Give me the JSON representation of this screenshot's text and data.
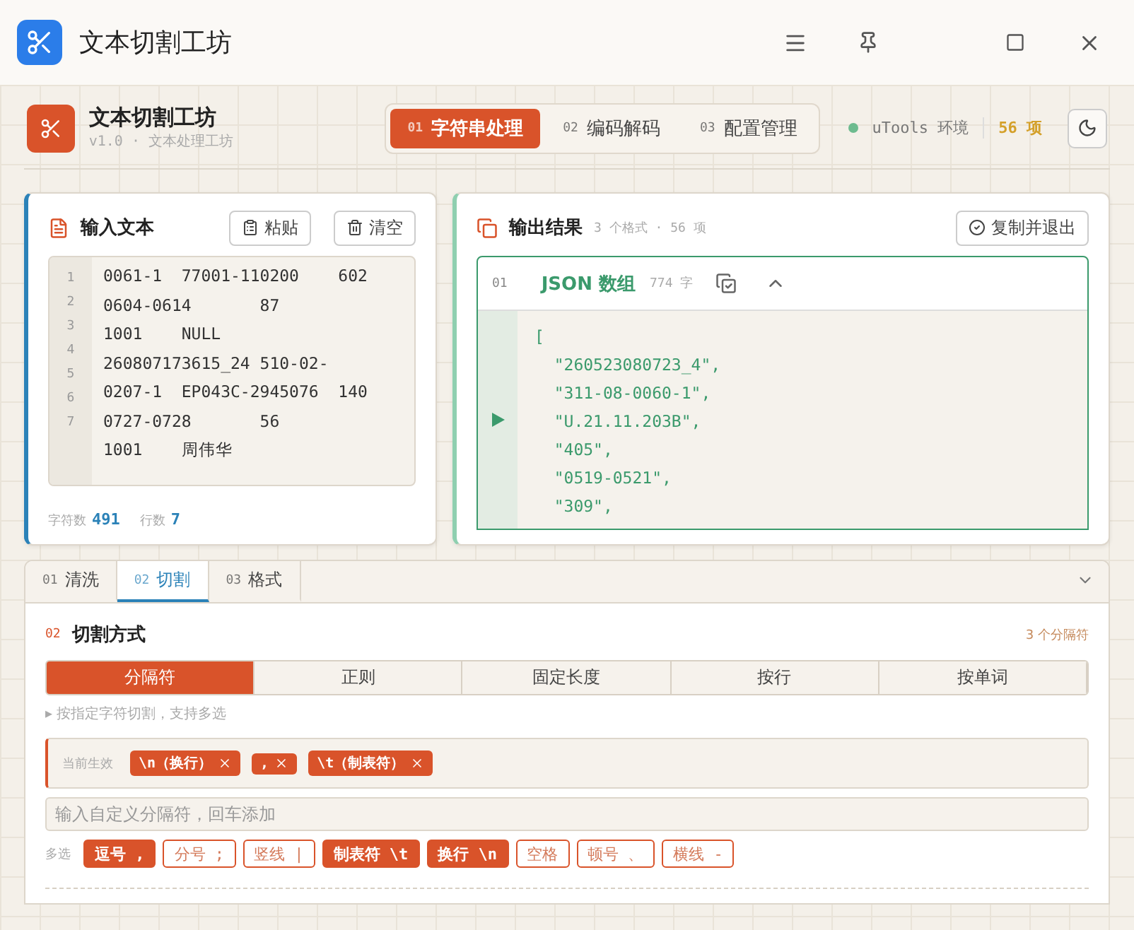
{
  "window": {
    "title": "文本切割工坊"
  },
  "header": {
    "app_name": "文本切割工坊",
    "subtitle": "v1.0 · 文本处理工坊",
    "env_label": "uTools 环境",
    "count": "56 项",
    "tabs": [
      {
        "index": "01",
        "label": "字符串处理",
        "selected": true
      },
      {
        "index": "02",
        "label": "编码解码",
        "selected": false
      },
      {
        "index": "03",
        "label": "配置管理",
        "selected": false
      }
    ]
  },
  "input_panel": {
    "title": "输入文本",
    "paste": "粘贴",
    "clear": "清空",
    "line_numbers": [
      "1",
      "2",
      "3",
      "4",
      "5",
      "6",
      "7"
    ],
    "lines": [
      "0061-1  77001-110200    602",
      "0604-0614       87",
      "1001    NULL",
      "260807173615_24 510-02-",
      "0207-1  EP043C-2945076  140",
      "0727-0728       56",
      "1001    周伟华"
    ],
    "stats": [
      {
        "label": "字符数",
        "value": "491"
      },
      {
        "label": "行数",
        "value": "7"
      }
    ]
  },
  "output_panel": {
    "title": "输出结果",
    "meta": "3 个格式 · 56 项",
    "copy_exit": "复制并退出",
    "block": {
      "index": "01",
      "name": "JSON 数组",
      "size": "774 字",
      "expanded": true,
      "lines": [
        "[",
        "  \"260523080723_4\",",
        "  \"311-08-0060-1\",",
        "  \"U.21.11.203B\",",
        "  \"405\",",
        "  \"0519-0521\",",
        "  \"309\","
      ]
    }
  },
  "settings": {
    "tabs": [
      {
        "index": "01",
        "label": "清洗",
        "selected": false
      },
      {
        "index": "02",
        "label": "切割",
        "selected": true
      },
      {
        "index": "03",
        "label": "格式",
        "selected": false
      }
    ],
    "section": {
      "index": "02",
      "title": "切割方式",
      "count": "3 个分隔符"
    },
    "modes": [
      {
        "label": "分隔符",
        "selected": true
      },
      {
        "label": "正则",
        "selected": false
      },
      {
        "label": "固定长度",
        "selected": false
      },
      {
        "label": "按行",
        "selected": false
      },
      {
        "label": "按单词",
        "selected": false
      }
    ],
    "hint": "▸ 按指定字符切割，支持多选",
    "active_label": "当前生效",
    "active_chips": [
      "\\n（换行）",
      ",",
      "\\t（制表符）"
    ],
    "custom_placeholder": "输入自定义分隔符，回车添加",
    "multi_label": "多选",
    "options": [
      {
        "label": "逗号 ,",
        "selected": true
      },
      {
        "label": "分号 ;",
        "selected": false
      },
      {
        "label": "竖线 |",
        "selected": false
      },
      {
        "label": "制表符 \\t",
        "selected": true
      },
      {
        "label": "换行 \\n",
        "selected": true
      },
      {
        "label": "空格",
        "selected": false
      },
      {
        "label": "顿号 、",
        "selected": false
      },
      {
        "label": "横线 -",
        "selected": false
      }
    ]
  }
}
